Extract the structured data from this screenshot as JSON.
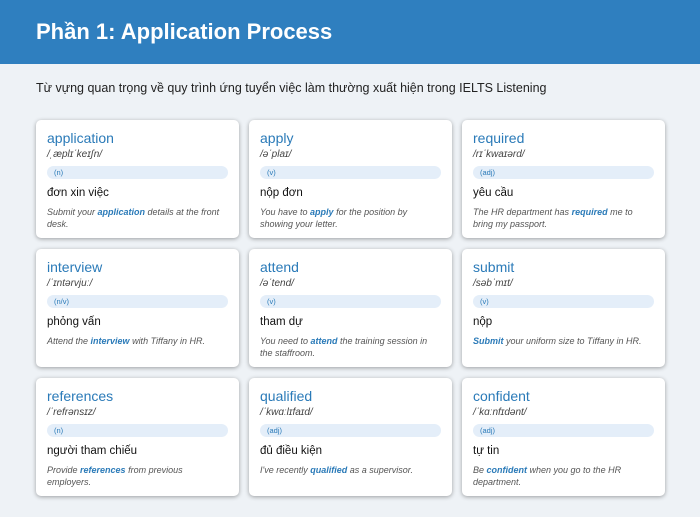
{
  "header": {
    "title": "Phần 1: Application Process"
  },
  "subtitle": "Từ vựng quan trọng về quy trình ứng tuyển việc làm thường xuất hiện trong IELTS Listening",
  "cards": [
    {
      "word": "application",
      "ipa": "/ˌæplɪˈkeɪʃn/",
      "pos": "(n)",
      "meaning": "đơn xin việc",
      "example": {
        "before": "Submit your ",
        "keyword": "application",
        "after": " details at the front desk."
      }
    },
    {
      "word": "apply",
      "ipa": "/əˈplaɪ/",
      "pos": "(v)",
      "meaning": "nộp đơn",
      "example": {
        "before": "You have to ",
        "keyword": "apply",
        "after": " for the position by showing your letter."
      }
    },
    {
      "word": "required",
      "ipa": "/rɪˈkwaɪərd/",
      "pos": "(adj)",
      "meaning": "yêu cầu",
      "example": {
        "before": "The HR department has ",
        "keyword": "required",
        "after": " me to bring my passport."
      }
    },
    {
      "word": "interview",
      "ipa": "/ˈɪntərvjuː/",
      "pos": "(n/v)",
      "meaning": "phỏng vấn",
      "example": {
        "before": "Attend the ",
        "keyword": "interview",
        "after": " with Tiffany in HR."
      }
    },
    {
      "word": "attend",
      "ipa": "/əˈtend/",
      "pos": "(v)",
      "meaning": "tham dự",
      "example": {
        "before": "You need to ",
        "keyword": "attend",
        "after": " the training session in the staffroom."
      }
    },
    {
      "word": "submit",
      "ipa": "/səbˈmɪt/",
      "pos": "(v)",
      "meaning": "nộp",
      "example": {
        "before": "",
        "keyword": "Submit",
        "after": " your uniform size to Tiffany in HR."
      }
    },
    {
      "word": "references",
      "ipa": "/ˈrefrənsɪz/",
      "pos": "(n)",
      "meaning": "người tham chiếu",
      "example": {
        "before": "Provide ",
        "keyword": "references",
        "after": " from previous employers."
      }
    },
    {
      "word": "qualified",
      "ipa": "/ˈkwɑːlɪfaɪd/",
      "pos": "(adj)",
      "meaning": "đủ điều kiện",
      "example": {
        "before": "I've recently ",
        "keyword": "qualified",
        "after": " as a supervisor."
      }
    },
    {
      "word": "confident",
      "ipa": "/ˈkɑːnfɪdənt/",
      "pos": "(adj)",
      "meaning": "tự tin",
      "example": {
        "before": "Be ",
        "keyword": "confident",
        "after": " when you go to the HR department."
      }
    }
  ],
  "colors": {
    "header_bg": "#2f7fbf",
    "accent": "#2a7ab8",
    "page_bg": "#eef2f6",
    "pos_bg": "#e4eef9"
  }
}
